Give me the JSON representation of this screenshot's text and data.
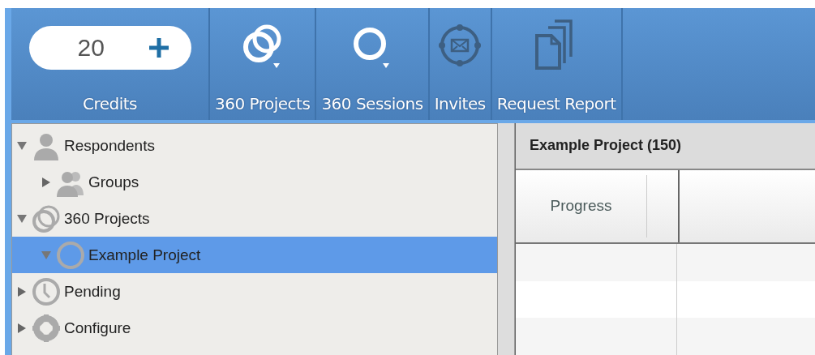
{
  "toolbar": {
    "credits": {
      "value": "20",
      "label": "Credits"
    },
    "items": [
      {
        "label": "360 Projects",
        "menu": true
      },
      {
        "label": "360 Sessions",
        "menu": true
      },
      {
        "label": "Invites",
        "menu": false
      },
      {
        "label": "Request Report",
        "menu": false
      }
    ]
  },
  "tree": [
    {
      "label": "Respondents",
      "expanded": true,
      "selected": false,
      "children": [
        {
          "label": "Groups",
          "expanded": false,
          "selected": false
        }
      ]
    },
    {
      "label": "360 Projects",
      "expanded": true,
      "selected": false,
      "children": [
        {
          "label": "Example Project",
          "expanded": true,
          "selected": true
        }
      ]
    },
    {
      "label": "Pending",
      "expanded": false,
      "selected": false
    },
    {
      "label": "Configure",
      "expanded": false,
      "selected": false
    }
  ],
  "panel": {
    "title": "Example Project (150)",
    "columns": [
      "Progress"
    ]
  }
}
